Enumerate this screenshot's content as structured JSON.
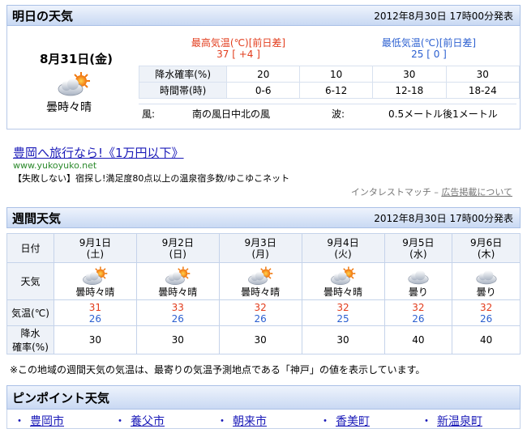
{
  "tomorrow": {
    "section_title": "明日の天気",
    "issued": "2012年8月30日 17時00分発表",
    "date": "8月31日(金)",
    "weather": "曇時々晴",
    "weather_icon": "cloud-sun-icon",
    "max_label": "最高気温(℃)[前日差]",
    "max_value": "37 [ +4 ]",
    "min_label": "最低気温(℃)[前日差]",
    "min_value": "25 [ 0 ]",
    "rain_label": "降水確率(%)",
    "rain_values": [
      "20",
      "10",
      "30",
      "30"
    ],
    "period_label": "時間帯(時)",
    "periods": [
      "0-6",
      "6-12",
      "12-18",
      "18-24"
    ],
    "wind_label": "風:",
    "wind_value": "南の風日中北の風",
    "wave_label": "波:",
    "wave_value": "0.5メートル後1メートル"
  },
  "ad": {
    "title": "豊岡へ旅行なら!《1万円以下》",
    "url": "www.yukoyuko.net",
    "desc": "【失敗しない】宿探し!満足度80点以上の温泉宿多数/ゆこゆこネット",
    "provider": "インタレストマッチ –",
    "about_link": "広告掲載について"
  },
  "weekly": {
    "section_title": "週間天気",
    "issued": "2012年8月30日 17時00分発表",
    "row_date": "日付",
    "row_weather": "天気",
    "row_temp": "気温(℃)",
    "row_rain_1": "降水",
    "row_rain_2": "確率(%)",
    "days": [
      {
        "date": "9月1日",
        "dow": "(土)",
        "icon": "cloud-sun-icon",
        "weather": "曇時々晴",
        "hi": "31",
        "lo": "26",
        "rain": "30"
      },
      {
        "date": "9月2日",
        "dow": "(日)",
        "icon": "cloud-sun-icon",
        "weather": "曇時々晴",
        "hi": "33",
        "lo": "26",
        "rain": "30"
      },
      {
        "date": "9月3日",
        "dow": "(月)",
        "icon": "cloud-sun-icon",
        "weather": "曇時々晴",
        "hi": "32",
        "lo": "26",
        "rain": "30"
      },
      {
        "date": "9月4日",
        "dow": "(火)",
        "icon": "cloud-sun-icon",
        "weather": "曇時々晴",
        "hi": "32",
        "lo": "25",
        "rain": "30"
      },
      {
        "date": "9月5日",
        "dow": "(水)",
        "icon": "cloud-icon",
        "weather": "曇り",
        "hi": "32",
        "lo": "26",
        "rain": "40"
      },
      {
        "date": "9月6日",
        "dow": "(木)",
        "icon": "cloud-icon",
        "weather": "曇り",
        "hi": "32",
        "lo": "26",
        "rain": "40"
      }
    ],
    "note": "※この地域の週間天気の気温は、最寄りの気温予測地点である「神戸」の値を表示しています。"
  },
  "pinpoint": {
    "section_title": "ピンポイント天気",
    "links": [
      "豊岡市",
      "養父市",
      "朝来市",
      "香美町",
      "新温泉町"
    ]
  },
  "colors": {
    "high_temp": "#e23c1c",
    "low_temp": "#2b5fd0",
    "link": "#1a1ab8",
    "header_bg": "#c9d9f3"
  }
}
